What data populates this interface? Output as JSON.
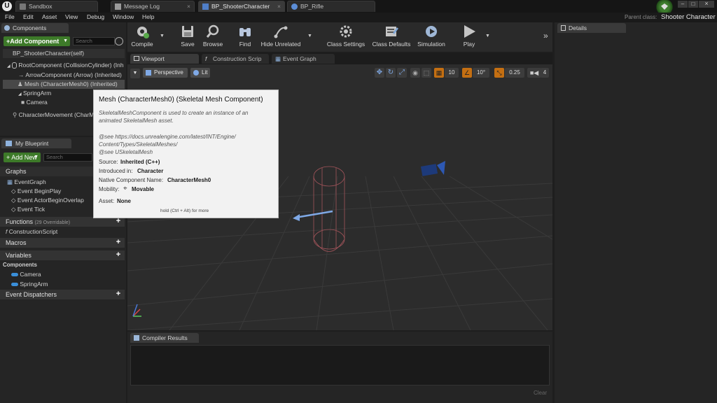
{
  "titlebar": {
    "tabs": [
      {
        "label": "Sandbox"
      },
      {
        "label": "Message Log"
      },
      {
        "label": "BP_ShooterCharacter"
      },
      {
        "label": "BP_Rifle"
      }
    ],
    "parent_class_label": "Parent class:",
    "parent_class_value": "Shooter Character"
  },
  "menu": [
    "File",
    "Edit",
    "Asset",
    "View",
    "Debug",
    "Window",
    "Help"
  ],
  "components_panel": {
    "title": "Components",
    "add_button": "+Add Component",
    "search_placeholder": "Search",
    "self_label": "BP_ShooterCharacter(self)",
    "items": [
      "RootComponent (CollisionCylinder) (Inh",
      "ArrowComponent (Arrow) (Inherited)",
      "Mesh (CharacterMesh0) (Inherited)",
      "SpringArm",
      "Camera",
      "CharacterMovement (CharM"
    ]
  },
  "my_blueprint": {
    "title": "My Blueprint",
    "add_button": "+ Add New",
    "search_placeholder": "Search",
    "graphs_label": "Graphs",
    "event_graph": "EventGraph",
    "events": [
      "Event BeginPlay",
      "Event ActorBeginOverlap",
      "Event Tick"
    ],
    "functions_label": "Functions",
    "functions_count": "(29 Overridable)",
    "construction_script": "ConstructionScript",
    "macros_label": "Macros",
    "variables_label": "Variables",
    "components_label": "Components",
    "component_vars": [
      "Camera",
      "SpringArm"
    ],
    "dispatchers_label": "Event Dispatchers"
  },
  "toolbar": {
    "compile": "Compile",
    "save": "Save",
    "browse": "Browse",
    "find": "Find",
    "hide_unrelated": "Hide Unrelated",
    "class_settings": "Class Settings",
    "class_defaults": "Class Defaults",
    "simulation": "Simulation",
    "play": "Play"
  },
  "editor_tabs": [
    "Viewport",
    "Construction Scrip",
    "Event Graph"
  ],
  "viewport": {
    "perspective": "Perspective",
    "lit": "Lit",
    "grid_snap": "10",
    "rot_snap": "10°",
    "scale_snap": "0.25",
    "camera_speed": "4"
  },
  "tooltip": {
    "title": "Mesh (CharacterMesh0) (Skeletal Mesh Component)",
    "desc1": "SkeletalMeshComponent is used to create an instance of an",
    "desc2": "animated SkeletalMesh asset.",
    "see1": "@see https://docs.unrealengine.com/latest/INT/Engine/",
    "see2": "Content/Types/SkeletalMeshes/",
    "see3": "@see USkeletalMesh",
    "source_label": "Source:",
    "source_value": "Inherited (C++)",
    "introduced_label": "Introduced in:",
    "introduced_value": "Character",
    "native_label": "Native Component Name:",
    "native_value": "CharacterMesh0",
    "mobility_label": "Mobility:",
    "mobility_value": "Movable",
    "asset_label": "Asset:",
    "asset_value": "None",
    "hint": "hold (Ctrl + Alt) for more"
  },
  "compiler": {
    "tab": "Compiler Results",
    "clear": "Clear"
  },
  "details": {
    "tab": "Details"
  },
  "colors": {
    "accent_green": "#3d7a29",
    "tooltip_bg": "#f2f2f2",
    "viewport_bg": "#2a2a2a"
  }
}
